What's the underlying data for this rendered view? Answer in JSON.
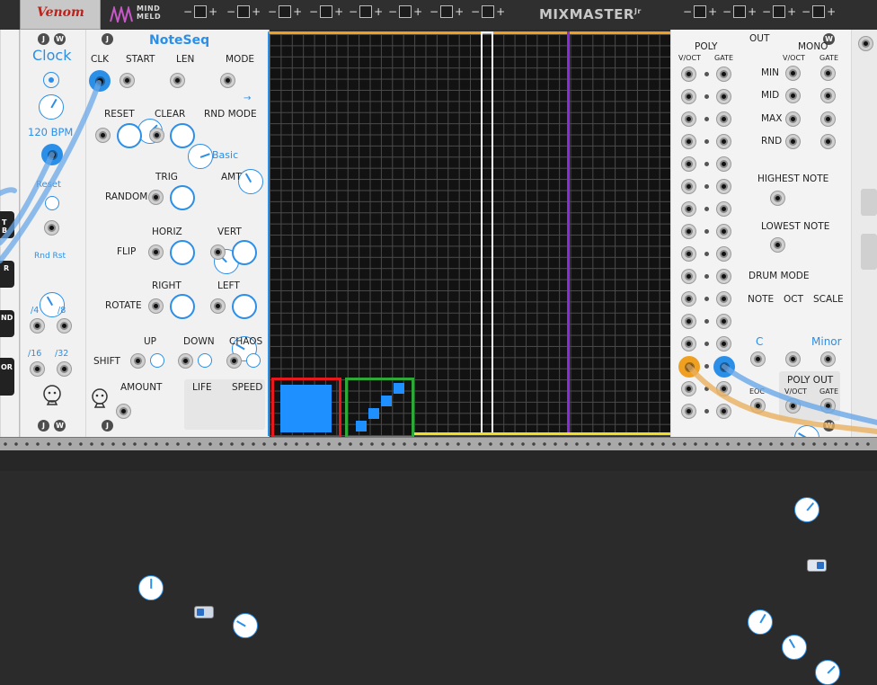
{
  "rack": {
    "venom_brand": "Venom",
    "mindmeld_brand_line1": "MIND",
    "mindmeld_brand_line2": "MELD",
    "mixmaster_title": "MIXMASTER",
    "mixmaster_suffix": "Jr",
    "trim_minus": "−",
    "trim_plus": "+"
  },
  "clock": {
    "screw_label_j": "J",
    "screw_label_w": "W",
    "title": "Clock",
    "bpm": "120 BPM",
    "reset": "Reset",
    "rnd_rst": "Rnd Rst",
    "div4": "/4",
    "div8": "/8",
    "div16": "/16",
    "div32": "/32"
  },
  "noteseq": {
    "title": "NoteSeq",
    "screw_label": "J",
    "clk": "CLK",
    "start": "START",
    "len": "LEN",
    "mode": "MODE",
    "mode_arrow": "→",
    "reset": "RESET",
    "clear": "CLEAR",
    "rnd_mode": "RND MODE",
    "rnd_mode_value": "Basic",
    "trig": "TRIG",
    "amt": "AMT",
    "random": "RANDOM",
    "horiz": "HORIZ",
    "vert": "VERT",
    "flip": "FLIP",
    "right": "RIGHT",
    "left": "LEFT",
    "rotate": "ROTATE",
    "up": "UP",
    "down": "DOWN",
    "chaos": "CHAOS",
    "shift": "SHIFT",
    "amount": "AMOUNT",
    "life": "LIFE",
    "speed": "SPEED"
  },
  "grid": {
    "highlights": [
      {
        "color": "#e8191c"
      },
      {
        "color": "#2ea836"
      }
    ],
    "playhead_color": "#ffffff",
    "length_marker_color": "#8a2be2",
    "bottom_bar_color": "#f0e020",
    "cell_on_color": "#1e90ff"
  },
  "output": {
    "out": "OUT",
    "poly": "POLY",
    "mono": "MONO",
    "voct": "V/OCT",
    "gate": "GATE",
    "min": "MIN",
    "mid": "MID",
    "max": "MAX",
    "rnd": "RND",
    "highest_note": "HIGHEST NOTE",
    "lowest_note": "LOWEST NOTE",
    "drum_mode": "DRUM MODE",
    "note": "NOTE",
    "oct": "OCT",
    "scale": "SCALE",
    "note_value": "C",
    "scale_value": "Minor",
    "eoc": "EOC",
    "poly_out": "POLY OUT",
    "poly_out_voct": "V/OCT",
    "poly_out_gate": "GATE",
    "screw_w": "W"
  },
  "left_panel": {
    "tag_b": "T B",
    "tag_r": "R",
    "tag_nd": "ND",
    "tag_or": "OR"
  }
}
